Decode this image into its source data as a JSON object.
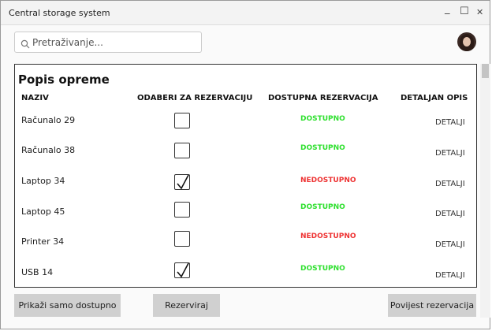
{
  "window": {
    "title": "Central storage system",
    "minimize": "_",
    "maximize": "☐",
    "close": "✕"
  },
  "search": {
    "placeholder": "Pretraživanje..."
  },
  "panel": {
    "title": "Popis opreme",
    "columns": {
      "naziv": "NAZIV",
      "odaberi": "ODABERI ZA REZERVACIJU",
      "dostupna": "DOSTUPNA REZERVACIJA",
      "opis": "DETALJAN OPIS"
    },
    "detail_label": "DETALJI",
    "rows": [
      {
        "name": "Računalo 29",
        "checked": false,
        "status": "DOSTUPNO",
        "available": true
      },
      {
        "name": "Računalo 38",
        "checked": false,
        "status": "DOSTUPNO",
        "available": true
      },
      {
        "name": "Laptop 34",
        "checked": true,
        "status": "NEDOSTUPNO",
        "available": false
      },
      {
        "name": "Laptop 45",
        "checked": false,
        "status": "DOSTUPNO",
        "available": true
      },
      {
        "name": "Printer 34",
        "checked": false,
        "status": "NEDOSTUPNO",
        "available": false
      },
      {
        "name": "USB 14",
        "checked": true,
        "status": "DOSTUPNO",
        "available": true
      }
    ]
  },
  "buttons": {
    "only_available": "Prikaži samo dostupno",
    "reserve": "Rezerviraj",
    "history": "Povijest rezervacija"
  },
  "colors": {
    "available": "#2fe02f",
    "unavailable": "#ee3333",
    "button_bg": "#d0d0d0"
  }
}
